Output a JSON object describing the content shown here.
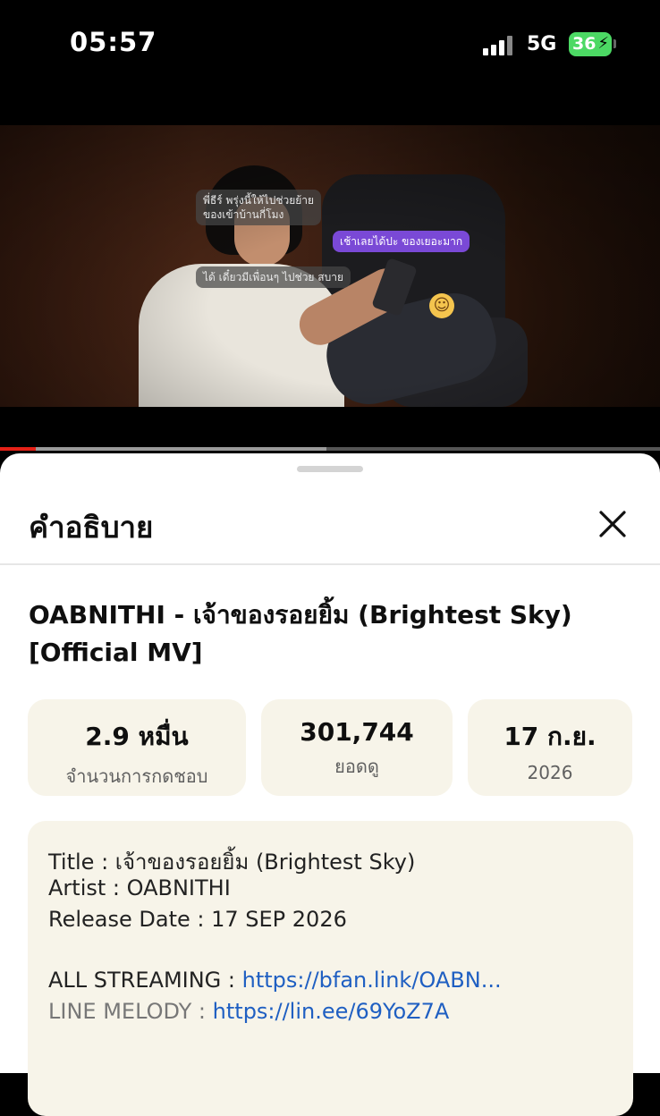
{
  "status_bar": {
    "time": "05:57",
    "network": "5G",
    "battery": "36"
  },
  "video": {
    "messages": [
      "พี่ธีร์ พรุ่งนี้ให้ไปช่วยย้าย\nของเข้าบ้านกี่โมง",
      "เช้าเลยได้ปะ ของเยอะมาก",
      "ได้ เดี๋ยวมีเพื่อนๆ ไปช่วย สบาย"
    ],
    "progress": 0.054
  },
  "sheet": {
    "title": "คำอธิบาย",
    "video_title": "OABNITHI - เจ้าของรอยยิ้ม (Brightest Sky) [Official MV]",
    "stats": {
      "likes_value": "2.9 หมื่น",
      "likes_label": "จำนวนการกดชอบ",
      "views_value": "301,744",
      "views_label": "ยอดดู",
      "date_value": "17 ก.ย.",
      "date_year": "2026"
    },
    "description": {
      "title_line": "Title : เจ้าของรอยยิ้ม (Brightest Sky)",
      "artist_line": "Artist : OABNITHI",
      "release_line": "Release Date : 17 SEP 2026",
      "streaming_label": "ALL STREAMING : ",
      "streaming_link": "https://bfan.link/OABN...",
      "melody_label": "LINE MELODY : ",
      "melody_link": "https://lin.ee/69YoZ7A"
    }
  },
  "colors": {
    "accent_red": "#e62117",
    "link_blue": "#1f5fc2",
    "card_bg": "#f7f4e9",
    "chat_purple": "#7a49d6"
  }
}
